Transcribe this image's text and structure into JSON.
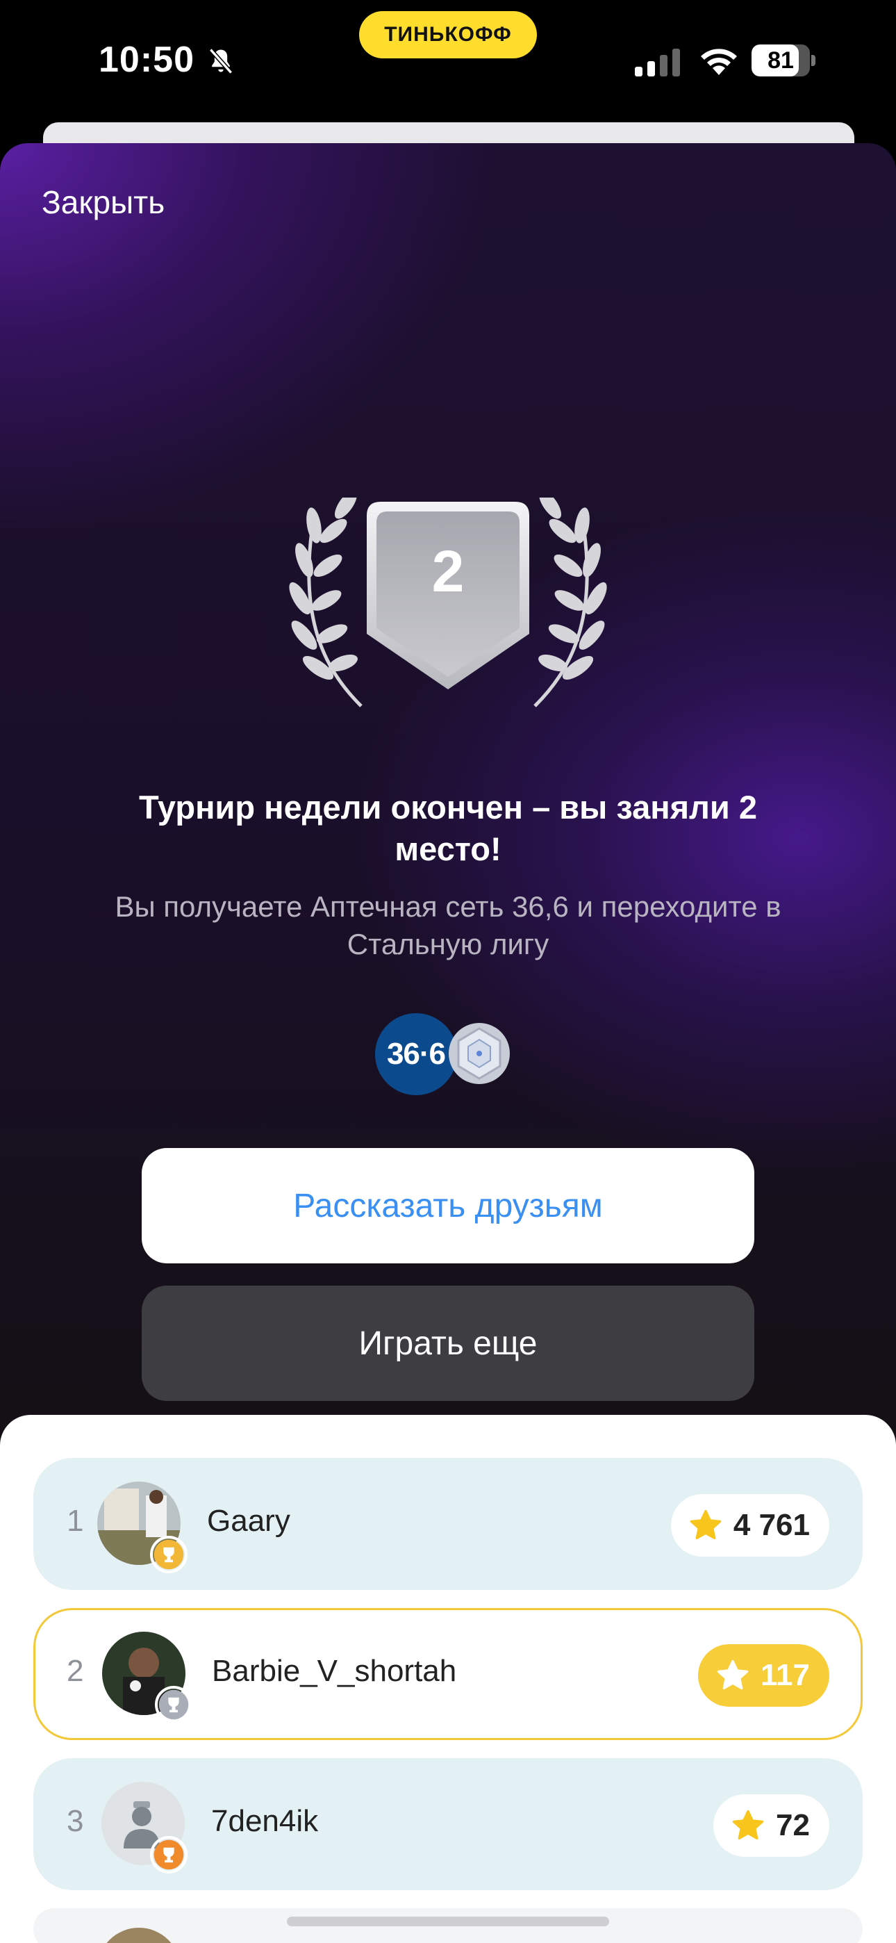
{
  "status_bar": {
    "time": "10:50",
    "brand": "ТИНЬКОФФ",
    "battery": "81",
    "battery_level": 0.81,
    "icons": [
      "bell-slash-icon",
      "cellular-signal-icon",
      "wifi-icon",
      "battery-icon"
    ]
  },
  "modal": {
    "close_label": "Закрыть",
    "place": "2",
    "title": "Турнир недели окончен – вы заняли 2 место!",
    "subtitle": "Вы получаете Аптечная сеть 36,6 и переходите в Стальную лигу",
    "reward_logo_text": "36·6",
    "share_button": "Рассказать друзьям",
    "play_button": "Играть еще"
  },
  "leaderboard": {
    "rows": [
      {
        "rank": "1",
        "name": "Gaary",
        "score": "4 761",
        "medal": "gold",
        "highlight": false
      },
      {
        "rank": "2",
        "name": "Barbie_V_shortah",
        "score": "117",
        "medal": "silver",
        "highlight": true
      },
      {
        "rank": "3",
        "name": "7den4ik",
        "score": "72",
        "medal": "bronze",
        "highlight": false
      }
    ]
  },
  "colors": {
    "brand_yellow": "#FFDD2D",
    "accent_blue": "#3A8FF2",
    "highlight_border": "#F3C93A",
    "row_bg": "#E3F0F4"
  }
}
